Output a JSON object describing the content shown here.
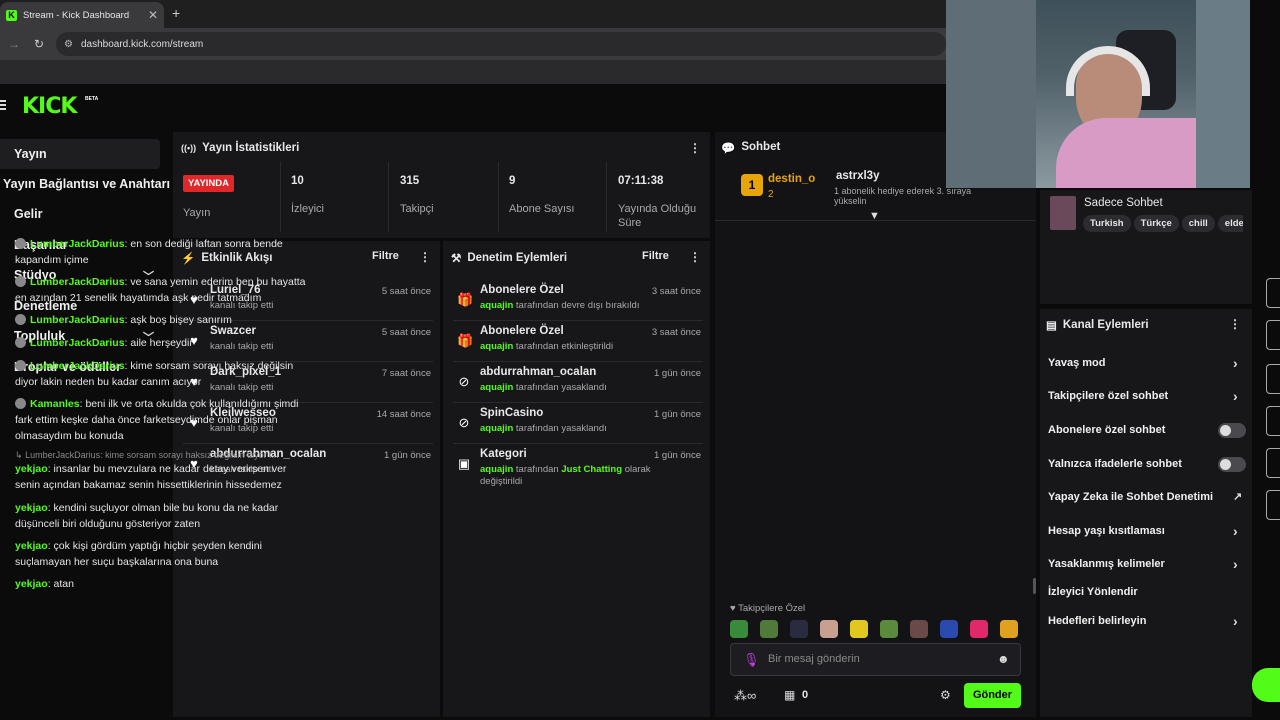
{
  "browser": {
    "tab_title": "Stream - Kick Dashboard",
    "favicon_letter": "K",
    "url": "dashboard.kick.com/stream"
  },
  "header": {
    "logo": "KICK",
    "beta": "BETA"
  },
  "sidebar": {
    "items": [
      {
        "label": "Yayın",
        "active": true
      },
      {
        "label": "Yayın Bağlantısı ve Anahtarı"
      },
      {
        "label": "Gelir"
      },
      {
        "label": "Başarılar"
      },
      {
        "label": "Stüdyo",
        "expandable": true
      },
      {
        "label": "Denetleme"
      },
      {
        "label": "Topluluk",
        "expandable": true
      },
      {
        "label": "Droplar ve ödüller"
      }
    ]
  },
  "stats": {
    "title": "Yayın İstatistikleri",
    "live_badge": "YAYINDA",
    "live_label": "Yayın",
    "viewers_value": "10",
    "viewers_label": "İzleyici",
    "followers_value": "315",
    "followers_label": "Takipçi",
    "subs_value": "9",
    "subs_label": "Abone Sayısı",
    "uptime_value": "07:11:38",
    "uptime_label": "Yayında Olduğu Süre"
  },
  "activity": {
    "title": "Etkinlik Akışı",
    "filter": "Filtre",
    "rows": [
      {
        "name": "Luriel_76",
        "sub": "kanalı takip etti",
        "time": "5 saat önce"
      },
      {
        "name": "Swazcer",
        "sub": "kanalı takip etti",
        "time": "5 saat önce"
      },
      {
        "name": "Dark_pixel_1",
        "sub": "kanalı takip etti",
        "time": "7 saat önce"
      },
      {
        "name": "Kleilwesseo",
        "sub": "kanalı takip etti",
        "time": "14 saat önce"
      },
      {
        "name": "abdurrahman_ocalan",
        "sub": "kanalı takip etti",
        "time": "1 gün önce"
      }
    ]
  },
  "moderation": {
    "title": "Denetim Eylemleri",
    "filter": "Filtre",
    "rows": [
      {
        "name": "Abonelere Özel",
        "actor": "aquajin",
        "sub": "tarafından devre dışı bırakıldı",
        "time": "3 saat önce"
      },
      {
        "name": "Abonelere Özel",
        "actor": "aquajin",
        "sub": "tarafından etkinleştirildi",
        "time": "3 saat önce"
      },
      {
        "name": "abdurrahman_ocalan",
        "actor": "aquajin",
        "sub": "tarafından yasaklandı",
        "time": "1 gün önce"
      },
      {
        "name": "SpinCasino",
        "actor": "aquajin",
        "sub": "tarafından yasaklandı",
        "time": "1 gün önce"
      },
      {
        "name": "Kategori",
        "actor": "aquajin",
        "sub": "tarafından",
        "category": "Just Chatting",
        "sub2": "olarak",
        "sub3": "değiştirildi",
        "time": "1 gün önce"
      }
    ]
  },
  "chat": {
    "title": "Sohbet",
    "pinned_user": "destin_o",
    "pinned_badge": "1",
    "pinned_count": "2",
    "gift_user": "astrxl3y",
    "gift_text": "1 abonelik hediye ederek 3. sıraya",
    "gift_text2": "yükselin",
    "messages": [
      {
        "user": "LumberJackDarius",
        "text": "en son dediği laftan sonra bende",
        "text2": "kapandım içime"
      },
      {
        "user": "LumberJackDarius",
        "text": "ve sana yemin ederim ben bu hayatta",
        "text2": "en azından 21 senelik hayatımda aşk nedir tatmadım"
      },
      {
        "user": "LumberJackDarius",
        "text": "aşk boş bişey sanırım"
      },
      {
        "user": "LumberJackDarius",
        "text": "aile herşeydir"
      },
      {
        "user": "LumberJackDarius",
        "text": "kime sorsam sorayı haksız değilsin",
        "text2": "diyor lakin neden bu kadar canım acıyor"
      },
      {
        "user": "Kamanles",
        "text": "beni ilk ve orta okulda çok kullanıldığımı şimdi",
        "text2": "fark ettim keşke daha önce farketseydimde onlar pişman",
        "text3": "olmasaydım bu konuda"
      }
    ],
    "reply_ref": "LumberJackDarius: kime sorsam sorayı haksız değilsin diyor l...",
    "yek_messages": [
      {
        "user": "yekjao",
        "text": "insanlar bu mevzulara ne kadar detay verirsen ver",
        "text2": "senin açından bakamaz senin hissettiklerinin hissedemez"
      },
      {
        "user": "yekjao",
        "text": "kendini suçluyor olman bile bu konu da ne kadar",
        "text2": "düşünceli biri olduğunu gösteriyor zaten"
      },
      {
        "user": "yekjao",
        "text": "çok kişi gördüm yaptığı hiçbir şeyden kendini",
        "text2": "suçlamayan her suçu başkalarına ona buna"
      },
      {
        "user": "yekjao",
        "text": "atan"
      }
    ],
    "followers_only": "Takipçilere Özel",
    "input_placeholder": "Bir mesaj gönderin",
    "points": "0",
    "send": "Gönder"
  },
  "right_panel": {
    "title": "Sadece Sohbet",
    "tags": [
      "Turkish",
      "Türkçe",
      "chill",
      "elde"
    ]
  },
  "channel_actions": {
    "title": "Kanal Eylemleri",
    "items": [
      {
        "label": "Yavaş mod",
        "control": "chevron"
      },
      {
        "label": "Takipçilere özel sohbet",
        "control": "chevron"
      },
      {
        "label": "Abonelere özel sohbet",
        "control": "toggle"
      },
      {
        "label": "Yalnızca ifadelerle sohbet",
        "control": "toggle"
      },
      {
        "label": "Yapay Zeka ile Sohbet Denetimi",
        "control": "external"
      },
      {
        "label": "Hesap yaşı kısıtlaması",
        "control": "chevron"
      },
      {
        "label": "Yasaklanmış kelimeler",
        "control": "chevron"
      },
      {
        "label": "İzleyici Yönlendir",
        "control": "none"
      },
      {
        "label": "Hedefleri belirleyin",
        "control": "chevron"
      }
    ]
  },
  "colors": {
    "accent": "#53fc18",
    "live": "#e0282a",
    "panel": "#17171a",
    "bg": "#0b0b0c"
  }
}
